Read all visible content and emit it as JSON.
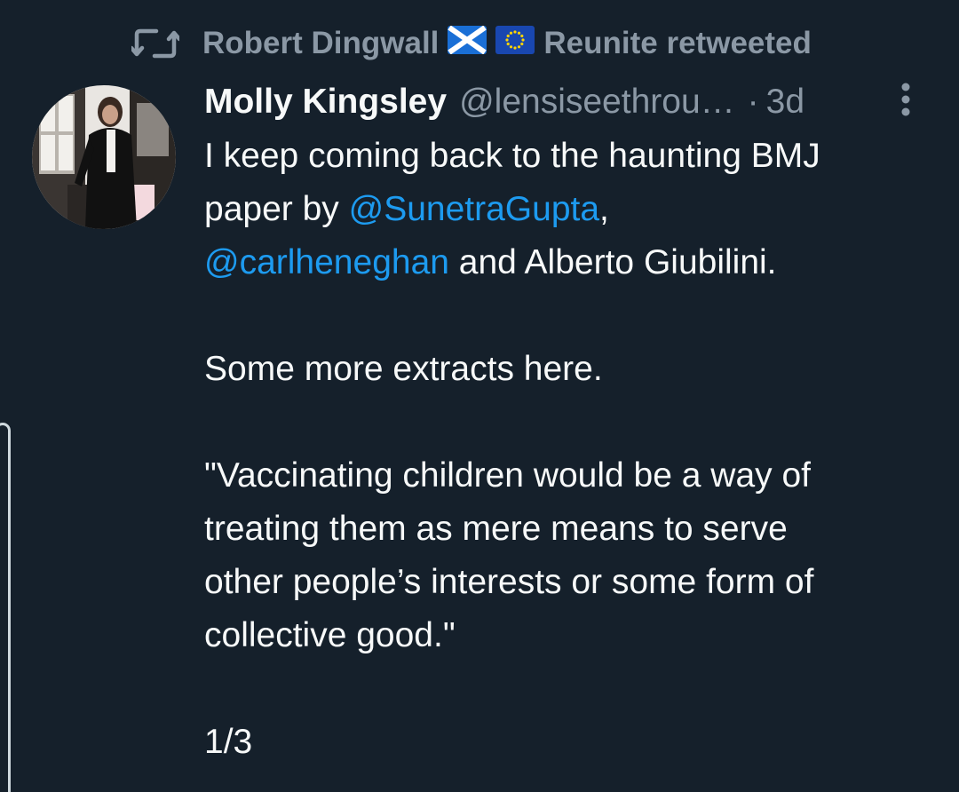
{
  "retweet": {
    "retweeter_name": "Robert Dingwall",
    "retweeter_suffix": "Reunite retweeted",
    "icon": "retweet-icon",
    "flags": [
      "scotland-flag",
      "eu-flag"
    ]
  },
  "tweet": {
    "author_name": "Molly Kingsley",
    "author_handle": "@lensiseethrou…",
    "separator": "·",
    "timestamp": "3d",
    "more_icon": "more-vertical-icon",
    "lines": {
      "l1": "I keep coming back to the haunting BMJ",
      "l2_text": "paper by ",
      "l2_mention": "@SunetraGupta",
      "l2_tail": ",",
      "l3_mention": "@carlheneghan",
      "l3_text": " and Alberto Giubilini.",
      "l5": "Some more extracts here.",
      "l7": "\"Vaccinating children would be a way of",
      "l8": "treating them as mere means to serve",
      "l9": "other people’s interests or some form of",
      "l10": "collective good.\"",
      "l12": "1/3"
    }
  },
  "colors": {
    "background": "#15202b",
    "text": "#f7f9f9",
    "secondary": "#8b98a5",
    "link": "#1d9bf0"
  }
}
